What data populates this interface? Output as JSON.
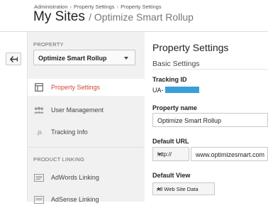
{
  "breadcrumb": {
    "items": [
      "Administration",
      "Property Settings",
      "Property Settings"
    ],
    "separator": "›"
  },
  "header": {
    "title": "My Sites",
    "subtitle": "/ Optimize Smart Rollup"
  },
  "sidebar": {
    "property_label": "PROPERTY",
    "property_select": "Optimize Smart Rollup",
    "items": [
      {
        "label": "Property Settings",
        "icon": "page-layout-icon",
        "active": true
      },
      {
        "label": "User Management",
        "icon": "users-icon",
        "active": false
      },
      {
        "label": "Tracking Info",
        "icon": "js-icon",
        "icon_text": ".js",
        "active": false
      }
    ],
    "product_linking_label": "PRODUCT LINKING",
    "linking_items": [
      {
        "label": "AdWords Linking",
        "icon": "adwords-icon"
      },
      {
        "label": "AdSense Linking",
        "icon": "adsense-icon"
      }
    ]
  },
  "main": {
    "title": "Property Settings",
    "section": "Basic Settings",
    "tracking_id_label": "Tracking ID",
    "tracking_id_prefix": "UA-",
    "property_name_label": "Property name",
    "property_name_value": "Optimize Smart Rollup",
    "default_url_label": "Default URL",
    "url_protocol": "http://",
    "url_value": "www.optimizesmart.com",
    "default_view_label": "Default View",
    "default_view_value": "All Web Site Data"
  },
  "colors": {
    "active_nav": "#d14836",
    "sidebar_bg": "#f1f1f1",
    "redaction": "#3a9fd9"
  }
}
